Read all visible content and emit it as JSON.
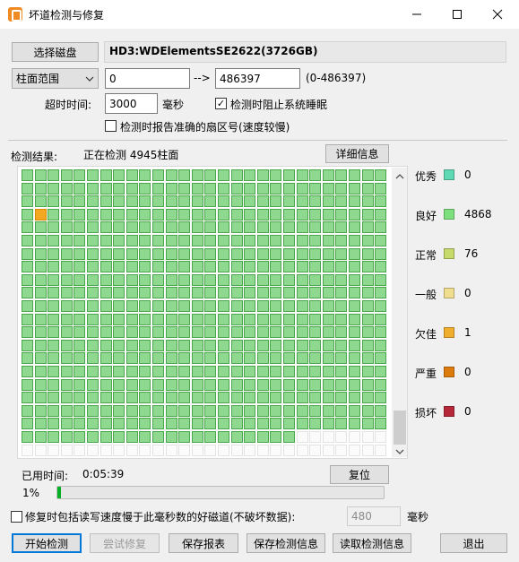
{
  "window": {
    "title": "坏道检测与修复"
  },
  "disk": {
    "select_button": "选择磁盘",
    "name": "HD3:WDElementsSE2622(3726GB)"
  },
  "range": {
    "mode": "柱面范围",
    "start": "0",
    "arrow": "-->",
    "end": "486397",
    "hint": "(0-486397)"
  },
  "timeout": {
    "label": "超时时间:",
    "value": "3000",
    "unit": "毫秒"
  },
  "options": {
    "prevent_sleep": {
      "label": "检测时阻止系统睡眠",
      "checked": true,
      "mark": "✓"
    },
    "report_sector": {
      "label": "检测时报告准确的扇区号(速度较慢)",
      "checked": false,
      "mark": ""
    }
  },
  "result": {
    "label": "检测结果:",
    "status": "正在检测 4945柱面",
    "details_button": "详细信息"
  },
  "grid": {
    "cols": 28,
    "rows": 22,
    "filled": 581,
    "warn_index": 85,
    "colors": {
      "good": "#8fd88f",
      "empty": "#fbfbfb",
      "warn": "#f4a720"
    }
  },
  "legend": [
    {
      "label": "优秀",
      "count": "0",
      "color": "#5fd9b3"
    },
    {
      "label": "良好",
      "count": "4868",
      "color": "#7ddf7d"
    },
    {
      "label": "正常",
      "count": "76",
      "color": "#c6d96b"
    },
    {
      "label": "一般",
      "count": "0",
      "color": "#f0de8e"
    },
    {
      "label": "欠佳",
      "count": "1",
      "color": "#f0ae2e"
    },
    {
      "label": "严重",
      "count": "0",
      "color": "#dc7a0c"
    },
    {
      "label": "损坏",
      "count": "0",
      "color": "#b5283a"
    }
  ],
  "elapsed": {
    "label": "已用时间:",
    "value": "0:05:39",
    "reset_button": "复位"
  },
  "progress": {
    "percent_label": "1%",
    "value": 0.01
  },
  "repair": {
    "include_label": "修复时包括读写速度慢于此毫秒数的好磁道(不破坏数据):",
    "threshold": "480",
    "unit": "毫秒",
    "checked": false
  },
  "buttons": {
    "start": "开始检测",
    "try_repair": "尝试修复",
    "save_report": "保存报表",
    "save_info": "保存检测信息",
    "load_info": "读取检测信息",
    "exit": "退出"
  }
}
